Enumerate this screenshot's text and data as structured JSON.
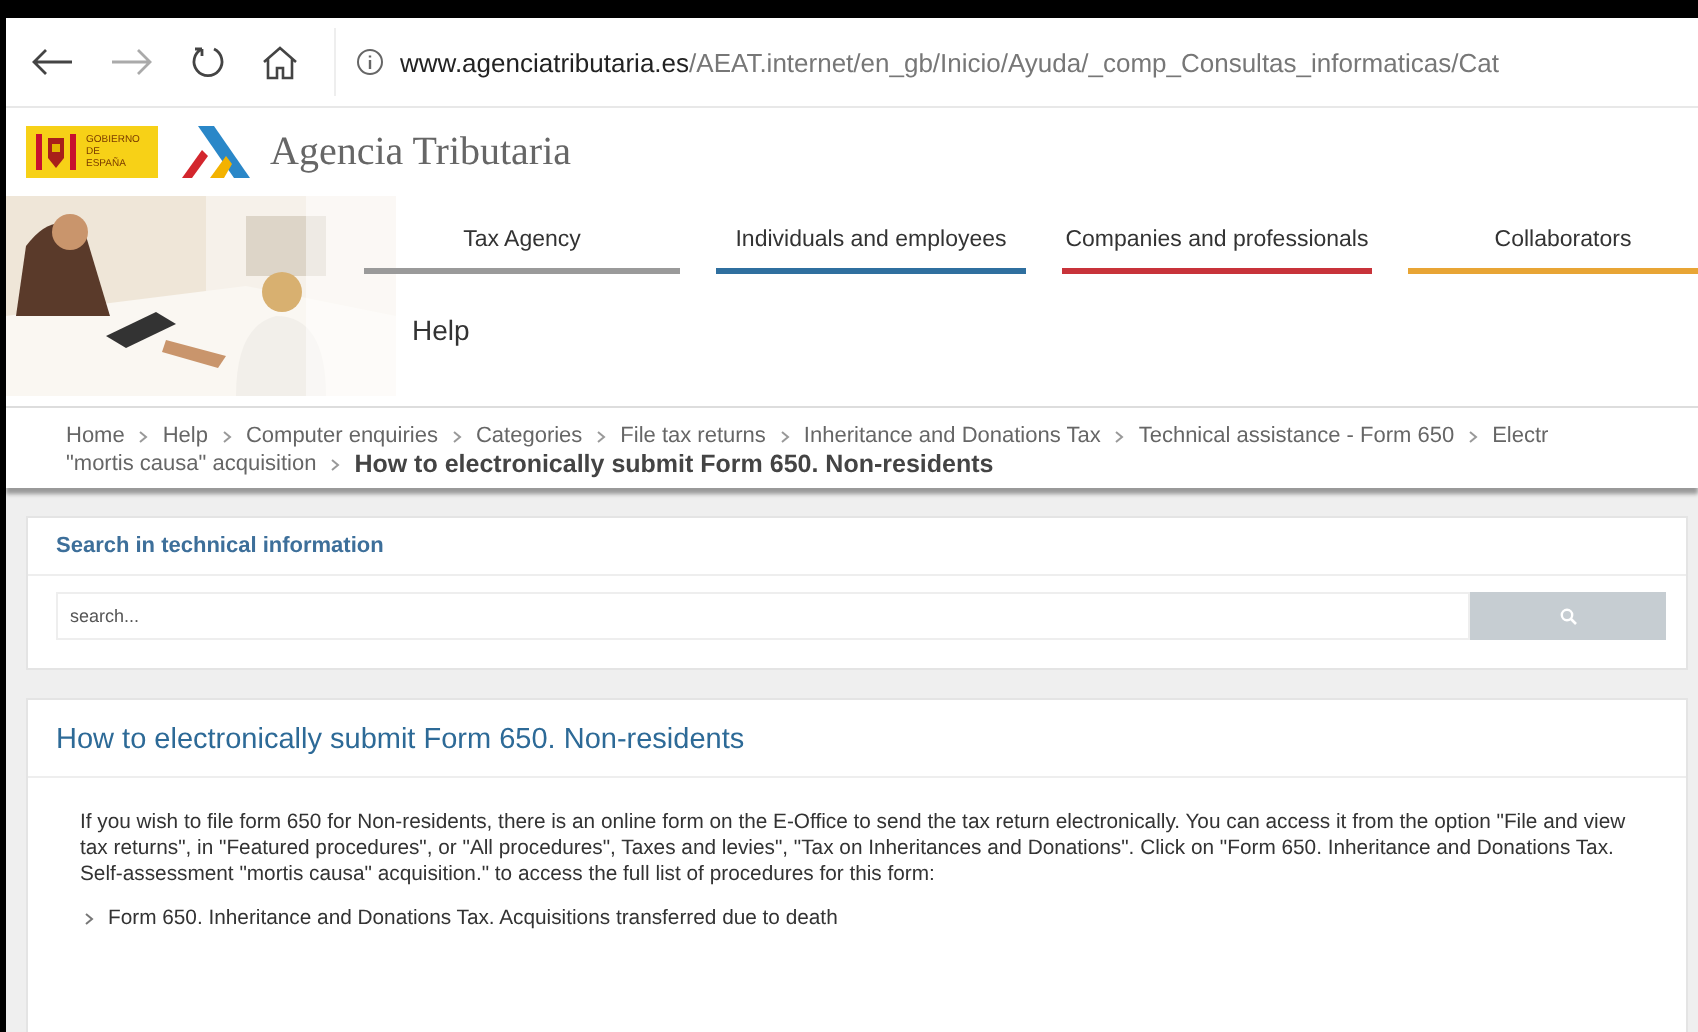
{
  "browser": {
    "url_host": "www.agenciatributaria.es",
    "url_path": "/AEAT.internet/en_gb/Inicio/Ayuda/_comp_Consultas_informaticas/Cat"
  },
  "logo": {
    "gov_text": "GOBIERNO DE ESPAÑA",
    "agency": "Agencia Tributaria"
  },
  "header": {
    "kind": "picture",
    "section": "Help"
  },
  "tabs": [
    {
      "label": "Tax Agency",
      "color": "#9a9a9a"
    },
    {
      "label": "Individuals and employees",
      "color": "#2f6f9f"
    },
    {
      "label": "Companies and professionals",
      "color": "#c8333a"
    },
    {
      "label": "Collaborators",
      "color": "#e8a535"
    }
  ],
  "breadcrumb": [
    [
      "Home",
      "Help",
      "Computer enquiries",
      "Categories",
      "File tax returns",
      "Inheritance and Donations Tax",
      "Technical assistance - Form 650",
      "Electr"
    ],
    [
      "\"mortis causa\" acquisition"
    ]
  ],
  "breadcrumb_current": "How to electronically submit Form 650. Non-residents",
  "search": {
    "title": "Search in technical information",
    "placeholder": "search..."
  },
  "article": {
    "title": "How to electronically submit Form 650. Non-residents",
    "body": "If you wish to file form 650 for Non-residents, there is an online form on the E-Office to send the tax return electronically. You can access it from the option \"File and view tax returns\", in \"Featured procedures\", or \"All procedures\", Taxes and levies\", \"Tax on Inheritances and Donations\". Click on \"Form 650. Inheritance and Donations Tax. Self-assessment \"mortis causa\" acquisition.\" to access the full list of procedures for this form:",
    "links": [
      "Form 650. Inheritance and Donations Tax. Acquisitions transferred due to death"
    ]
  }
}
